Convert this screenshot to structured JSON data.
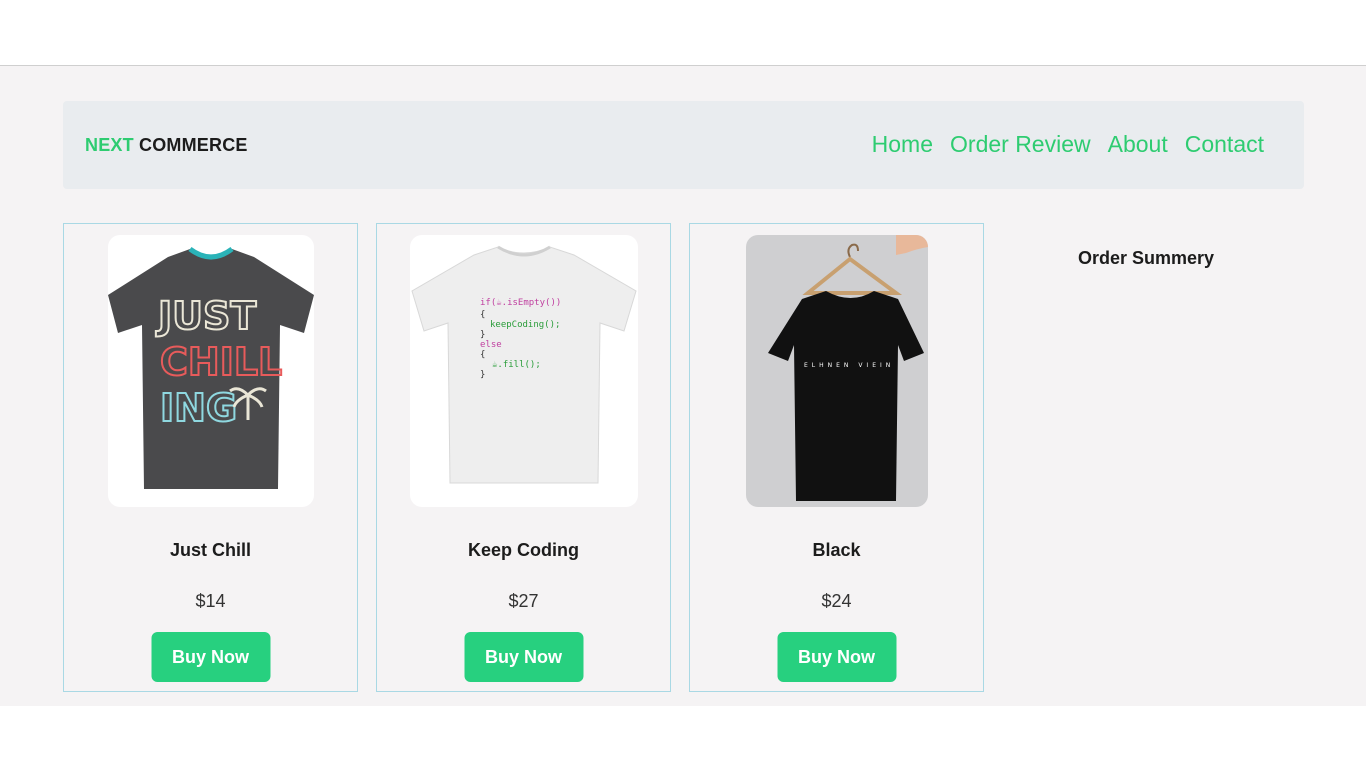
{
  "brand": {
    "part1": "NEXT",
    "part2": "COMMERCE"
  },
  "nav": {
    "links": [
      "Home",
      "Order Review",
      "About",
      "Contact"
    ]
  },
  "products": [
    {
      "name": "Just Chill",
      "price": "$14",
      "button": "Buy Now",
      "shirt_color": "#4a4a4c",
      "print_text": [
        "JUST",
        "CHILL",
        "ING"
      ]
    },
    {
      "name": "Keep Coding",
      "price": "$27",
      "button": "Buy Now",
      "shirt_color": "#eeeeee",
      "print_text": [
        "if(☕.isEmpty())",
        "{",
        "  keepCoding();",
        "}",
        "else",
        "{",
        "  ☕.fill();",
        "}"
      ]
    },
    {
      "name": "Black",
      "price": "$24",
      "button": "Buy Now",
      "shirt_color": "#111111",
      "print_text": [
        "ELHNEN VIEIN"
      ]
    }
  ],
  "summary": {
    "title": "Order Summery"
  },
  "colors": {
    "accent": "#2ecc71",
    "button": "#27d07f",
    "card_border": "#a9d8e4"
  }
}
